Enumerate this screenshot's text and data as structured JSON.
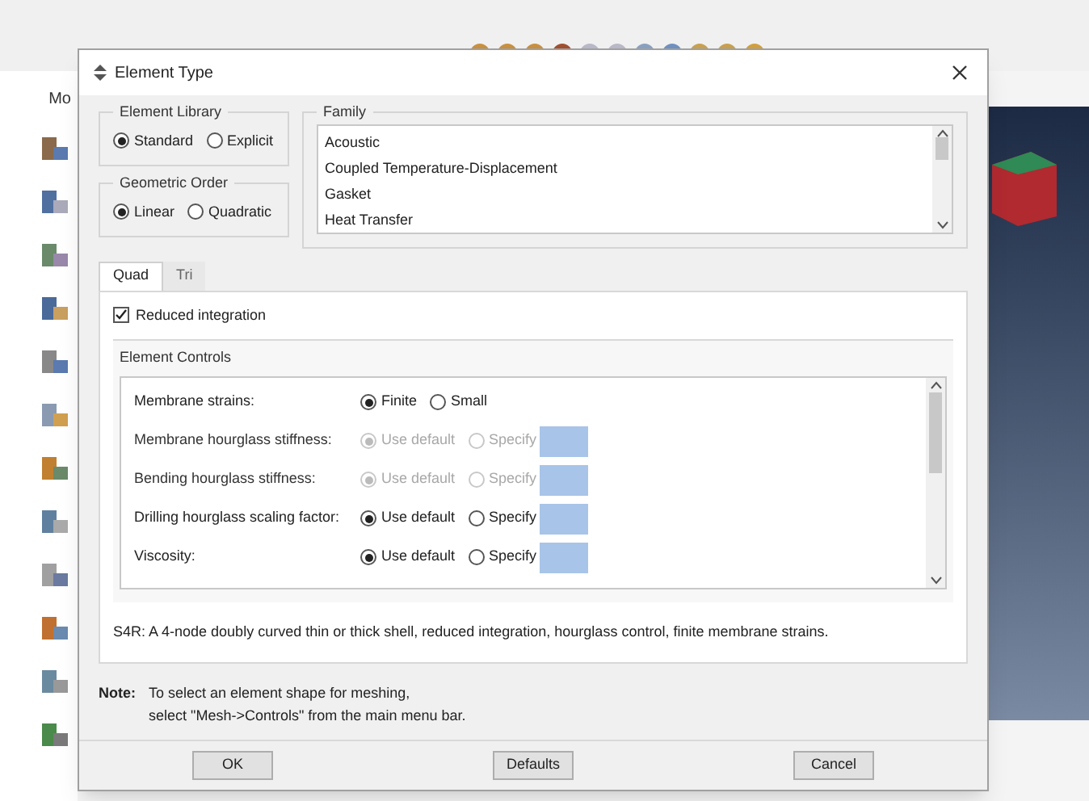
{
  "background": {
    "module_label": "Mo"
  },
  "dialog": {
    "title": "Element Type",
    "element_library": {
      "label": "Element Library",
      "options": [
        {
          "label": "Standard",
          "selected": true
        },
        {
          "label": "Explicit",
          "selected": false
        }
      ]
    },
    "family": {
      "label": "Family",
      "items": [
        "Acoustic",
        "Coupled Temperature-Displacement",
        "Gasket",
        "Heat Transfer"
      ]
    },
    "geometric_order": {
      "label": "Geometric Order",
      "options": [
        {
          "label": "Linear",
          "selected": true
        },
        {
          "label": "Quadratic",
          "selected": false
        }
      ]
    },
    "tabs": [
      {
        "label": "Quad",
        "selected": true
      },
      {
        "label": "Tri",
        "selected": false
      }
    ],
    "reduced_integration": {
      "label": "Reduced integration",
      "checked": true
    },
    "element_controls": {
      "label": "Element Controls",
      "rows": [
        {
          "kind": "radio",
          "label": "Membrane strains:",
          "disabled": false,
          "options": [
            {
              "label": "Finite",
              "selected": true
            },
            {
              "label": "Small",
              "selected": false
            }
          ]
        },
        {
          "kind": "specify",
          "label": "Membrane hourglass stiffness:",
          "disabled": true,
          "options": [
            {
              "label": "Use default",
              "selected": true
            },
            {
              "label": "Specify",
              "selected": false
            }
          ]
        },
        {
          "kind": "specify",
          "label": "Bending hourglass stiffness:",
          "disabled": true,
          "options": [
            {
              "label": "Use default",
              "selected": true
            },
            {
              "label": "Specify",
              "selected": false
            }
          ]
        },
        {
          "kind": "specify",
          "label": "Drilling hourglass scaling factor:",
          "disabled": false,
          "options": [
            {
              "label": "Use default",
              "selected": true
            },
            {
              "label": "Specify",
              "selected": false
            }
          ]
        },
        {
          "kind": "specify",
          "label": "Viscosity:",
          "disabled": false,
          "options": [
            {
              "label": "Use default",
              "selected": true
            },
            {
              "label": "Specify",
              "selected": false
            }
          ]
        }
      ]
    },
    "description": "S4R:  A 4-node doubly curved thin or thick shell, reduced integration, hourglass control, finite membrane strains.",
    "note": {
      "label": "Note:",
      "lines": [
        "To select an element shape for meshing,",
        "select \"Mesh->Controls\" from the main menu bar."
      ]
    },
    "buttons": [
      "OK",
      "Defaults",
      "Cancel"
    ]
  }
}
